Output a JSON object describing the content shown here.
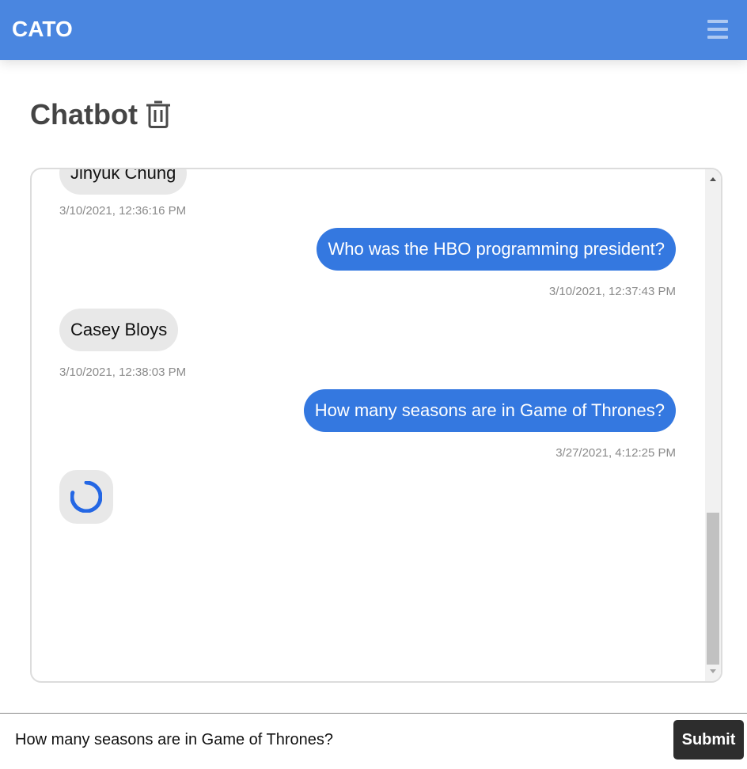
{
  "navbar": {
    "brand": "CATO",
    "menu_icon": "hamburger-icon",
    "color": "#4a86e0"
  },
  "page": {
    "title": "Chatbot",
    "delete_icon": "trash-icon"
  },
  "chat": {
    "messages": [
      {
        "sender": "bot",
        "text": "Jinyuk Chung",
        "timestamp": "3/10/2021, 12:36:16 PM"
      },
      {
        "sender": "user",
        "text": "Who was the HBO programming president?",
        "timestamp": "3/10/2021, 12:37:43 PM"
      },
      {
        "sender": "bot",
        "text": "Casey Bloys",
        "timestamp": "3/10/2021, 12:38:03 PM"
      },
      {
        "sender": "user",
        "text": "How many seasons are in Game of Thrones?",
        "timestamp": "3/27/2021, 4:12:25 PM"
      }
    ],
    "loading_icon": "spinner-icon",
    "colors": {
      "user_bubble": "#3478e0",
      "bot_bubble": "#e8e8e8"
    }
  },
  "input": {
    "value": "How many seasons are in Game of Thrones?",
    "submit_label": "Submit"
  }
}
